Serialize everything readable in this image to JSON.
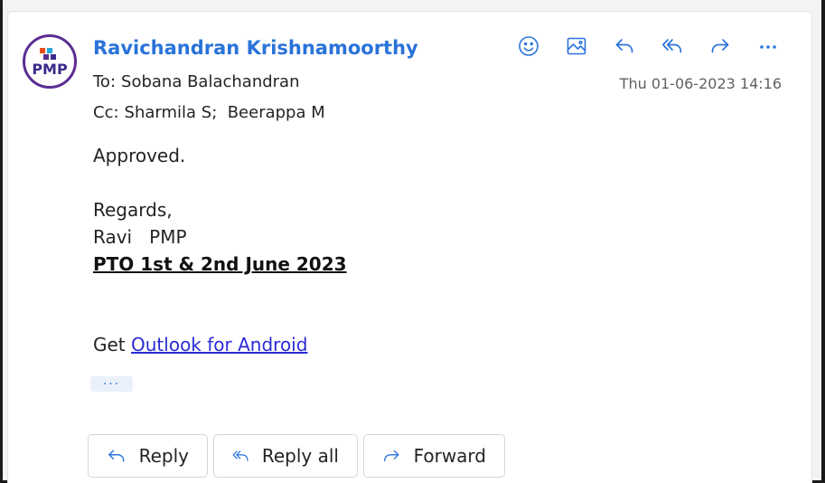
{
  "colors": {
    "accent": "#2a73d9",
    "avatar_ring": "#5b2d91",
    "link": "#2b2bd6"
  },
  "avatar": {
    "text": "PMP",
    "icon": "pmi-logo-icon"
  },
  "message": {
    "sender": "Ravichandran Krishnamoorthy",
    "to_label": "To:",
    "to": "Sobana Balachandran",
    "cc_label": "Cc:",
    "cc": "Sharmila S;  Beerappa M",
    "timestamp": "Thu 01-06-2023 14:16"
  },
  "toolbar": {
    "icons": [
      "emoji-icon",
      "image-icon",
      "reply-icon",
      "reply-all-icon",
      "forward-icon",
      "more-icon"
    ]
  },
  "body": {
    "line1": "Approved.",
    "regards": "Regards,",
    "signature": "Ravi   PMP",
    "pto": "PTO 1st & 2nd June 2023",
    "get_prefix": "Get ",
    "get_link": "Outlook for Android",
    "expand_label": "···"
  },
  "reply_bar": {
    "reply": "Reply",
    "reply_all": "Reply all",
    "forward": "Forward"
  }
}
